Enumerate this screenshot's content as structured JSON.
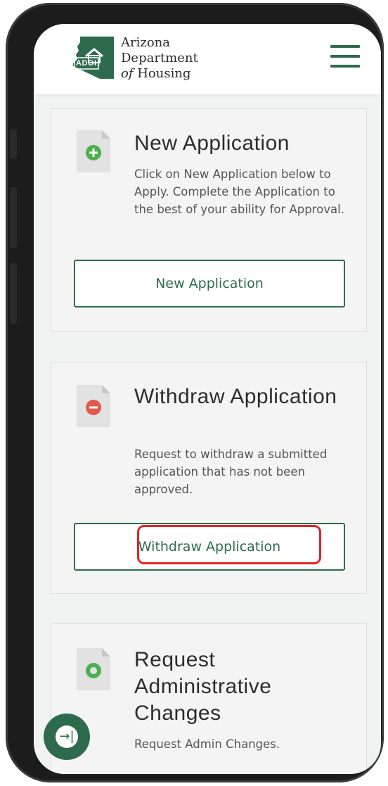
{
  "header": {
    "logo": {
      "line1": "Arizona",
      "line2": "Department",
      "line3_prefix": "of",
      "line3_rest": " Housing",
      "abbr": "ADOH"
    },
    "menu_icon": "hamburger-menu-icon"
  },
  "cards": [
    {
      "title": "New Application",
      "description": "Click on New Application below to Apply. Complete the Application to the best of your ability for Approval.",
      "button_label": "New Application",
      "icon": "add-document-icon",
      "icon_color": "#4caf50"
    },
    {
      "title": "Withdraw Application",
      "description": "Request to withdraw a submitted application that has not been approved.",
      "button_label": "Withdraw Application",
      "icon": "remove-document-icon",
      "icon_color": "#e05a4f"
    },
    {
      "title": "Request Administrative Changes",
      "description": "Request Admin Changes.",
      "icon": "change-document-icon",
      "icon_color": "#4caf50"
    }
  ],
  "fab": {
    "icon": "expand-panel-icon",
    "glyph": "→|"
  },
  "colors": {
    "brand_green": "#2e6b4c",
    "highlight_red": "#e0242b",
    "background": "#f1f2f2"
  }
}
